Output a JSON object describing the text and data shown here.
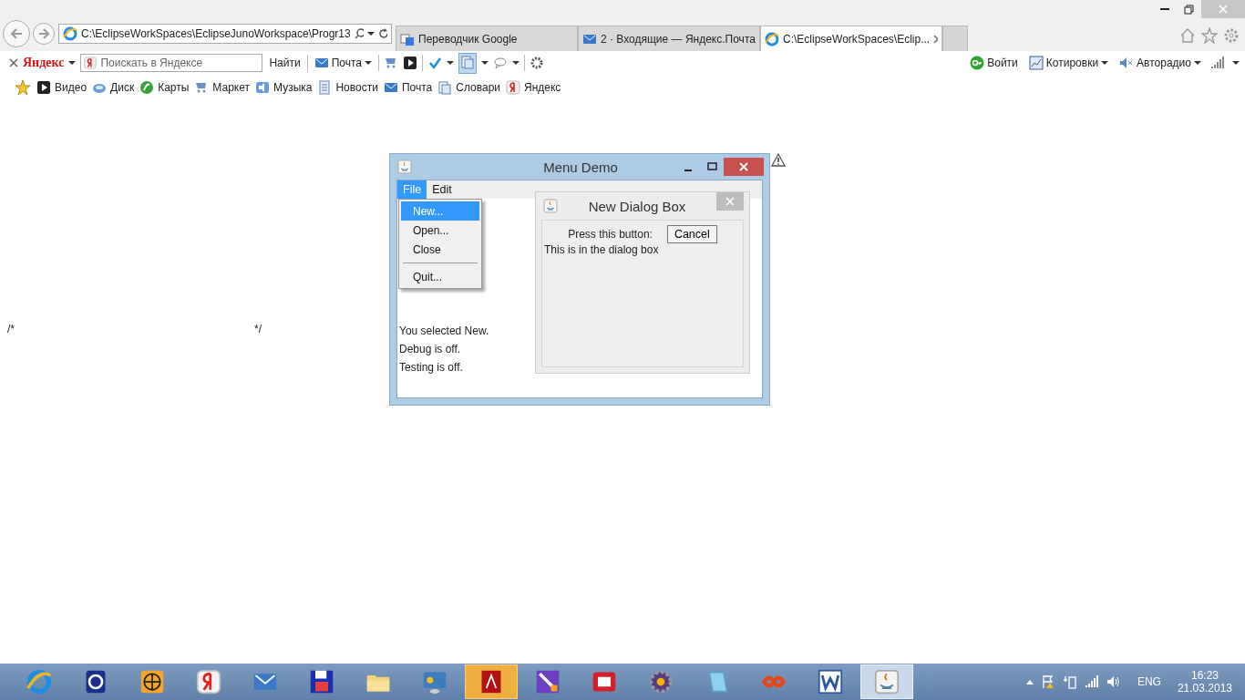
{
  "browser": {
    "address": "C:\\EclipseWorkSpaces\\EclipseJunoWorkspace\\Progr13",
    "tabs": [
      {
        "title": "Переводчик Google",
        "kind": "translate",
        "selected": false
      },
      {
        "title": "2 · Входящие — Яндекс.Почта",
        "kind": "mail",
        "selected": false
      },
      {
        "title": "C:\\EclipseWorkSpaces\\Eclip...",
        "kind": "ie",
        "selected": true
      }
    ],
    "toolbar": {
      "logo": "Яндекс",
      "search_placeholder": "Поискать в Яндексе",
      "search_button": "Найти",
      "mail": "Почта",
      "login": "Войти",
      "quotes": "Котировки",
      "radio": {
        "label": "Авторадио",
        "muted": true
      }
    },
    "bookmarks": [
      {
        "label": "Видео",
        "kind": "video"
      },
      {
        "label": "Диск",
        "kind": "disk"
      },
      {
        "label": "Карты",
        "kind": "maps"
      },
      {
        "label": "Маркет",
        "kind": "market"
      },
      {
        "label": "Музыка",
        "kind": "music"
      },
      {
        "label": "Новости",
        "kind": "news"
      },
      {
        "label": "Почта",
        "kind": "mail"
      },
      {
        "label": "Словари",
        "kind": "dict"
      },
      {
        "label": "Яндекс",
        "kind": "yandex"
      }
    ]
  },
  "page": {
    "comment_open": "/*",
    "comment_close": "*/"
  },
  "menu_demo": {
    "title": "Menu Demo",
    "menus": [
      {
        "label": "File",
        "selected": true
      },
      {
        "label": "Edit",
        "selected": false
      }
    ],
    "file_menu": [
      {
        "kind": "item",
        "label": "New...",
        "selected": true
      },
      {
        "kind": "item",
        "label": "Open...",
        "selected": false
      },
      {
        "kind": "item",
        "label": "Close",
        "selected": false
      },
      {
        "kind": "separator"
      },
      {
        "kind": "item",
        "label": "Quit...",
        "selected": false
      }
    ],
    "status": [
      "You selected New.",
      "Debug is off.",
      "Testing is off."
    ],
    "dialog": {
      "title": "New Dialog Box",
      "prompt": "Press this button:",
      "button": "Cancel",
      "text": "This is in the dialog box"
    }
  },
  "taskbar": {
    "apps": [
      {
        "kind": "ie",
        "selected": false,
        "attention": false
      },
      {
        "kind": "help",
        "selected": false,
        "attention": false
      },
      {
        "kind": "globe",
        "selected": false,
        "attention": false
      },
      {
        "kind": "yandex",
        "selected": false,
        "attention": false
      },
      {
        "kind": "mail",
        "selected": false,
        "attention": false
      },
      {
        "kind": "floppy",
        "selected": false,
        "attention": false
      },
      {
        "kind": "folder",
        "selected": false,
        "attention": false
      },
      {
        "kind": "panel",
        "selected": false,
        "attention": false
      },
      {
        "kind": "pdf",
        "selected": false,
        "attention": true
      },
      {
        "kind": "pen",
        "selected": false,
        "attention": false
      },
      {
        "kind": "fr",
        "selected": false,
        "attention": false
      },
      {
        "kind": "gear",
        "selected": false,
        "attention": false
      },
      {
        "kind": "notepad",
        "selected": false,
        "attention": false
      },
      {
        "kind": "infinity",
        "selected": false,
        "attention": false
      },
      {
        "kind": "word",
        "selected": false,
        "attention": false
      },
      {
        "kind": "java",
        "selected": true,
        "attention": false
      }
    ],
    "language": "ENG",
    "time": "16:23",
    "date": "21.03.2013"
  }
}
